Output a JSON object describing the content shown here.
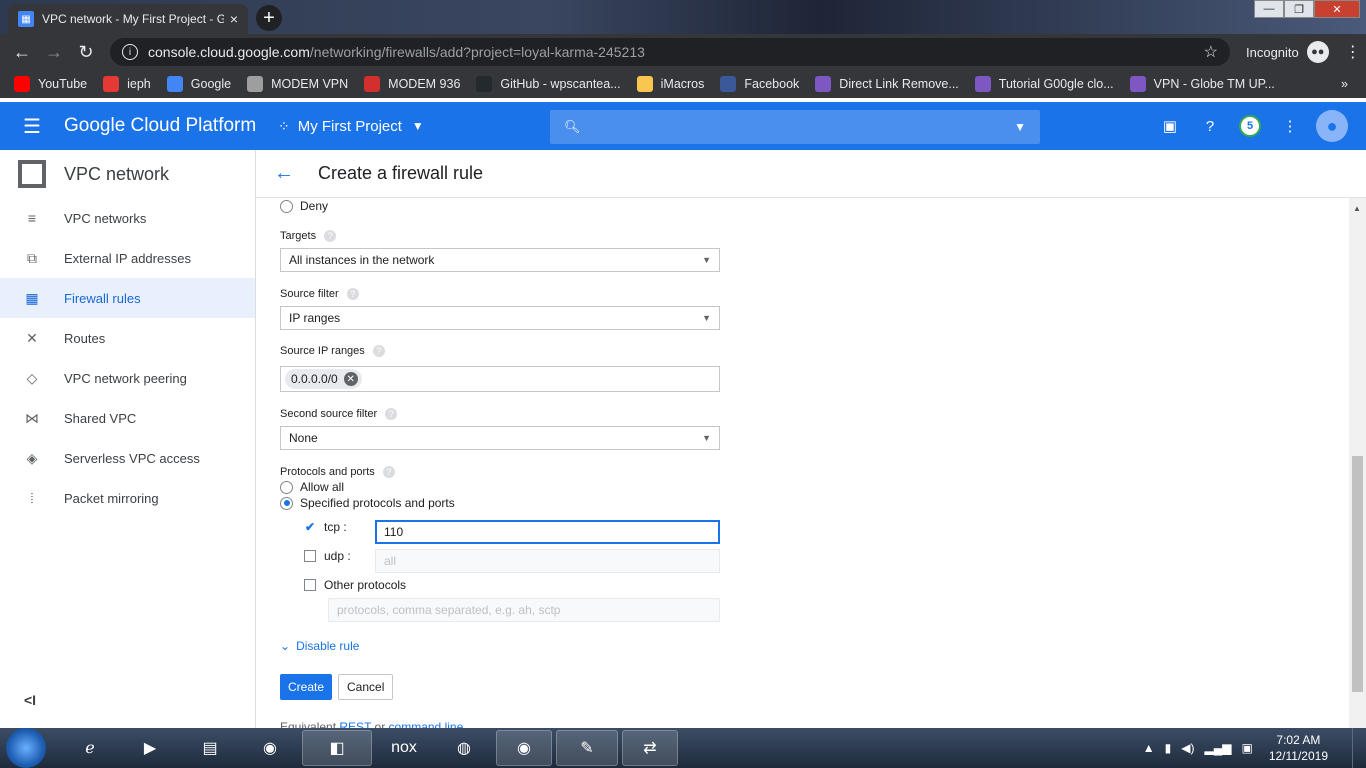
{
  "browser": {
    "tab_title": "VPC network - My First Project - G",
    "tab_close": "×",
    "new_tab": "+",
    "url_host": "console.cloud.google.com",
    "url_path": "/networking/firewalls/add?project=loyal-karma-245213",
    "incognito_label": "Incognito",
    "bookmarks": [
      {
        "label": "YouTube",
        "icon": "youtube-icon",
        "color": "#ff0000"
      },
      {
        "label": "ieph",
        "icon": "p-icon",
        "color": "#e53935"
      },
      {
        "label": "Google",
        "icon": "google-icon",
        "color": "#4285f4"
      },
      {
        "label": "MODEM VPN",
        "icon": "globe-icon",
        "color": "#9e9e9e"
      },
      {
        "label": "MODEM 936",
        "icon": "huawei-icon",
        "color": "#d32f2f"
      },
      {
        "label": "GitHub - wpscantea...",
        "icon": "github-icon",
        "color": "#24292e"
      },
      {
        "label": "iMacros",
        "icon": "folder-icon",
        "color": "#f9c74f"
      },
      {
        "label": "Facebook",
        "icon": "facebook-icon",
        "color": "#3b5998"
      },
      {
        "label": "Direct Link Remove...",
        "icon": "shield-icon",
        "color": "#7e57c2"
      },
      {
        "label": "Tutorial G00gle clo...",
        "icon": "shield-icon",
        "color": "#7e57c2"
      },
      {
        "label": "VPN - Globe TM UP...",
        "icon": "shield-icon",
        "color": "#7e57c2"
      }
    ],
    "more_bookmarks": "»"
  },
  "header": {
    "brand": "Google Cloud Platform",
    "project": "My First Project",
    "notification_count": "5"
  },
  "sidebar": {
    "title": "VPC network",
    "items": [
      {
        "label": "VPC networks",
        "icon": "≡",
        "name": "sidebar-item-vpc-networks",
        "active": false
      },
      {
        "label": "External IP addresses",
        "icon": "⧉",
        "name": "sidebar-item-external-ip",
        "active": false
      },
      {
        "label": "Firewall rules",
        "icon": "▦",
        "name": "sidebar-item-firewall-rules",
        "active": true
      },
      {
        "label": "Routes",
        "icon": "✕",
        "name": "sidebar-item-routes",
        "active": false
      },
      {
        "label": "VPC network peering",
        "icon": "◇",
        "name": "sidebar-item-peering",
        "active": false
      },
      {
        "label": "Shared VPC",
        "icon": "⋈",
        "name": "sidebar-item-shared-vpc",
        "active": false
      },
      {
        "label": "Serverless VPC access",
        "icon": "◈",
        "name": "sidebar-item-serverless",
        "active": false
      },
      {
        "label": "Packet mirroring",
        "icon": "⦙",
        "name": "sidebar-item-packet-mirroring",
        "active": false
      }
    ],
    "collapse": "<I"
  },
  "page": {
    "title": "Create a firewall rule"
  },
  "form": {
    "deny_label": "Deny",
    "targets_label": "Targets",
    "targets_value": "All instances in the network",
    "source_filter_label": "Source filter",
    "source_filter_value": "IP ranges",
    "source_ip_ranges_label": "Source IP ranges",
    "source_ip_chip": "0.0.0.0/0",
    "second_source_filter_label": "Second source filter",
    "second_source_filter_value": "None",
    "protocols_label": "Protocols and ports",
    "allow_all_label": "Allow all",
    "specified_label": "Specified protocols and ports",
    "tcp_label": "tcp :",
    "tcp_value": "110",
    "udp_label": "udp :",
    "udp_placeholder": "all",
    "other_label": "Other protocols",
    "other_placeholder": "protocols, comma separated, e.g. ah, sctp",
    "disable_rule": "Disable rule",
    "create": "Create",
    "cancel": "Cancel",
    "equivalent_prefix": "Equivalent",
    "equivalent_rest": "REST",
    "equivalent_or": "or",
    "equivalent_cli": "command line"
  },
  "taskbar": {
    "time": "7:02 AM",
    "date": "12/11/2019"
  }
}
